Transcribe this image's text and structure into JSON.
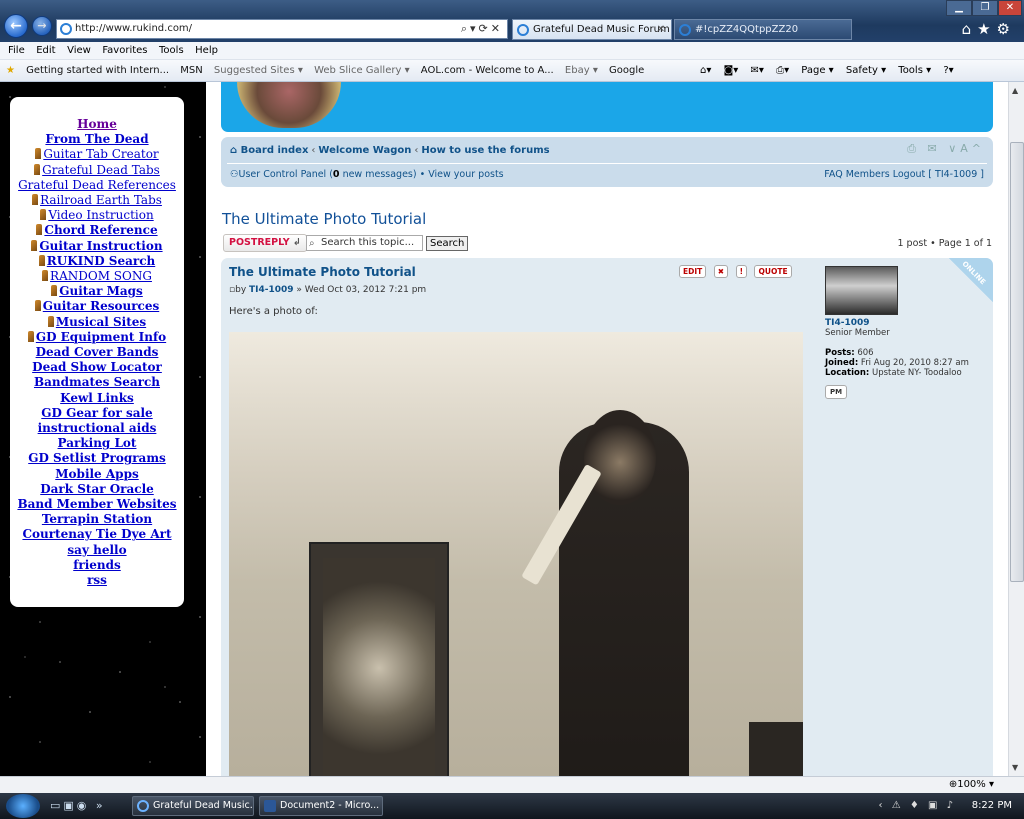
{
  "browser": {
    "url": "http://www.rukind.com/",
    "tabs": [
      {
        "label": "Grateful Dead Music Forum"
      },
      {
        "label": "#!cpZZ4QQtppZZ20"
      }
    ],
    "menu": [
      "File",
      "Edit",
      "View",
      "Favorites",
      "Tools",
      "Help"
    ],
    "favorites": [
      "Getting started with Intern...",
      "MSN",
      "Suggested Sites ▾",
      "Web Slice Gallery ▾",
      "AOL.com - Welcome to A...",
      "Ebay ▾",
      "Google"
    ],
    "command_bar": [
      "Page ▾",
      "Safety ▾",
      "Tools ▾"
    ],
    "zoom": "100%"
  },
  "sidebar": {
    "links": [
      {
        "label": "Home",
        "style": "home"
      },
      {
        "label": "From The Dead",
        "style": "bold"
      },
      {
        "label": "Guitar Tab Creator",
        "style": "icon"
      },
      {
        "label": "Grateful Dead Tabs",
        "style": "icon"
      },
      {
        "label": "Grateful Dead References",
        "style": "plain"
      },
      {
        "label": "Railroad Earth Tabs",
        "style": "icon"
      },
      {
        "label": "Video Instruction",
        "style": "icon"
      },
      {
        "label": "Chord Reference",
        "style": "icon-bold"
      },
      {
        "label": "Guitar Instruction",
        "style": "icon-bold"
      },
      {
        "label": "RUKIND Search",
        "style": "icon-bold"
      },
      {
        "label": "RANDOM SONG",
        "style": "icon"
      },
      {
        "label": "Guitar Mags",
        "style": "icon-bold"
      },
      {
        "label": "Guitar Resources",
        "style": "icon-bold"
      },
      {
        "label": "Musical Sites",
        "style": "icon-bold"
      },
      {
        "label": "GD Equipment Info",
        "style": "icon-bold"
      },
      {
        "label": "Dead Cover Bands",
        "style": "bold"
      },
      {
        "label": "Dead Show Locator",
        "style": "bold"
      },
      {
        "label": "Bandmates Search",
        "style": "bold"
      },
      {
        "label": "Kewl Links",
        "style": "bold"
      },
      {
        "label": "GD Gear for sale",
        "style": "bold"
      },
      {
        "label": "instructional aids",
        "style": "bold"
      },
      {
        "label": "Parking Lot",
        "style": "bold"
      },
      {
        "label": "GD Setlist Programs",
        "style": "bold"
      },
      {
        "label": "Mobile Apps",
        "style": "bold"
      },
      {
        "label": "Dark Star Oracle",
        "style": "bold"
      },
      {
        "label": "Band Member Websites",
        "style": "bold"
      },
      {
        "label": "Terrapin Station",
        "style": "bold"
      },
      {
        "label": "Courtenay Tie Dye Art",
        "style": "bold"
      },
      {
        "label": "say hello",
        "style": "bold"
      },
      {
        "label": "friends",
        "style": "bold"
      },
      {
        "label": "rss",
        "style": "bold"
      }
    ]
  },
  "forum": {
    "breadcrumbs": [
      "Board index",
      "Welcome Wagon",
      "How to use the forums"
    ],
    "ucp_label": "User Control Panel (",
    "ucp_count": "0",
    "ucp_suffix": " new messages) • View your posts",
    "header_right": "FAQ  Members  Logout [ TI4-1009 ]",
    "topic_title": "The Ultimate Photo Tutorial",
    "postreply_label": "POSTREPLY",
    "search_placeholder": "Search this topic...",
    "search_button": "Search",
    "pagination": "1 post • Page 1 of 1",
    "post": {
      "title": "The Ultimate Photo Tutorial",
      "by_prefix": "by ",
      "author": "TI4-1009",
      "date": " » Wed Oct 03, 2012 7:21 pm",
      "text": "Here's a photo of:",
      "buttons": [
        "EDIT",
        "✖",
        "!",
        "QUOTE"
      ]
    },
    "profile": {
      "name": "TI4-1009",
      "rank": "Senior Member",
      "posts_label": "Posts:",
      "posts": "606",
      "joined_label": "Joined:",
      "joined": "Fri Aug 20, 2010 8:27 am",
      "location_label": "Location:",
      "location": "Upstate NY- Toodaloo",
      "pm_label": "PM",
      "status": "ONLINE"
    }
  },
  "taskbar": {
    "tasks": [
      "Grateful Dead Music...",
      "Document2 - Micro..."
    ],
    "time": "8:22 PM"
  }
}
